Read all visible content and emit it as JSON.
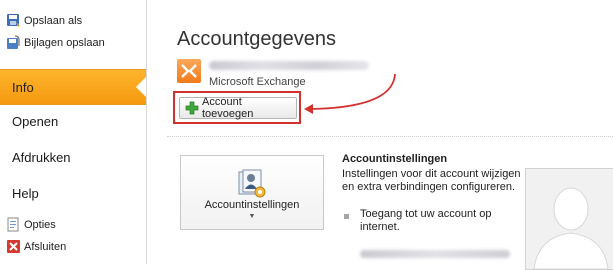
{
  "sidebar": {
    "save_as": "Opslaan als",
    "save_attachments": "Bijlagen opslaan",
    "info": "Info",
    "open": "Openen",
    "print": "Afdrukken",
    "help": "Help",
    "options": "Opties",
    "exit": "Afsluiten"
  },
  "main": {
    "title": "Accountgegevens",
    "account_type": "Microsoft Exchange",
    "add_account_label": "Account toevoegen",
    "tile_label": "Accountinstellingen",
    "tile_arrow": "▼",
    "panel_title": "Accountinstellingen",
    "panel_desc": "Instellingen voor dit account wijzigen en extra verbindingen configureren.",
    "bullet_text": "Toegang tot uw account op internet."
  },
  "colors": {
    "selected_tab": "#f59a10",
    "annotation": "#d4312e",
    "plus_icon": "#3fa83a"
  }
}
